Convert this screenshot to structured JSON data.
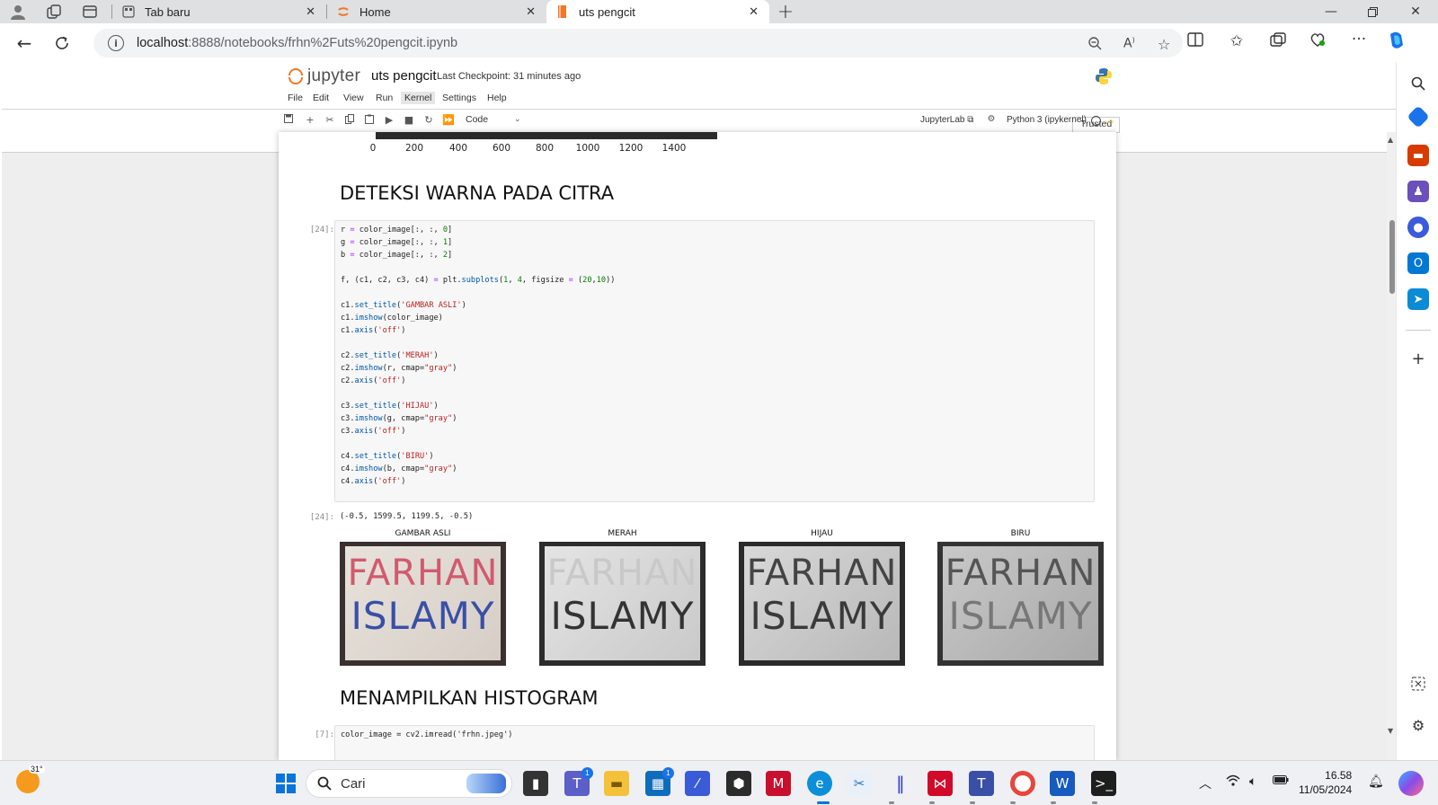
{
  "browser": {
    "tabs": [
      {
        "label": "Tab baru",
        "active": false
      },
      {
        "label": "Home",
        "active": false
      },
      {
        "label": "uts pengcit",
        "active": true
      }
    ],
    "url_host": "localhost",
    "url_path": ":8888/notebooks/frhn%2Futs%20pengcit.ipynb"
  },
  "jupyter": {
    "logo_text": "jupyter",
    "notebook_name": "uts pengcit",
    "checkpoint": "Last Checkpoint: 31 minutes ago",
    "menu": [
      "File",
      "Edit",
      "View",
      "Run",
      "Kernel",
      "Settings",
      "Help"
    ],
    "highlighted_menu": "Kernel",
    "trusted": "Trusted",
    "cell_type": "Code",
    "jupyterlab_link": "JupyterLab",
    "kernel_name": "Python 3 (ipykernel)"
  },
  "notebook": {
    "prev_xticks": [
      "0",
      "200",
      "400",
      "600",
      "800",
      "1000",
      "1200",
      "1400"
    ],
    "heading1": "DETEKSI WARNA PADA CITRA",
    "cell1_prompt": "[24]:",
    "cell1_code": [
      "r = color_image[:, :, 0]",
      "g = color_image[:, :, 1]",
      "b = color_image[:, :, 2]",
      "",
      "f, (c1, c2, c3, c4) = plt.subplots(1, 4, figsize = (20,10))",
      "",
      "c1.set_title('GAMBAR ASLI')",
      "c1.imshow(color_image)",
      "c1.axis('off')",
      "",
      "c2.set_title('MERAH')",
      "c2.imshow(r, cmap=\"gray\")",
      "c2.axis('off')",
      "",
      "c3.set_title('HIJAU')",
      "c3.imshow(g, cmap=\"gray\")",
      "c3.axis('off')",
      "",
      "c4.set_title('BIRU')",
      "c4.imshow(b, cmap=\"gray\")",
      "c4.axis('off')"
    ],
    "output_prompt": "[24]:",
    "output_text": "(-0.5, 1599.5, 1199.5, -0.5)",
    "figures": [
      {
        "title": "GAMBAR ASLI",
        "line1": "FARHAN",
        "line2": "ISLAMY"
      },
      {
        "title": "MERAH",
        "line1": "FARHAN",
        "line2": "ISLAMY"
      },
      {
        "title": "HIJAU",
        "line1": "FARHAN",
        "line2": "ISLAMY"
      },
      {
        "title": "BIRU",
        "line1": "FARHAN",
        "line2": "ISLAMY"
      }
    ],
    "heading2": "MENAMPILKAN HISTOGRAM",
    "cell2_prompt": "[7]:",
    "cell2_code": "color_image = cv2.imread('frhn.jpeg')"
  },
  "taskbar": {
    "weather_temp": "31°",
    "search_label": "Cari",
    "time": "16.58",
    "date": "11/05/2024",
    "teams_badge": "1",
    "store_badge": "1"
  }
}
